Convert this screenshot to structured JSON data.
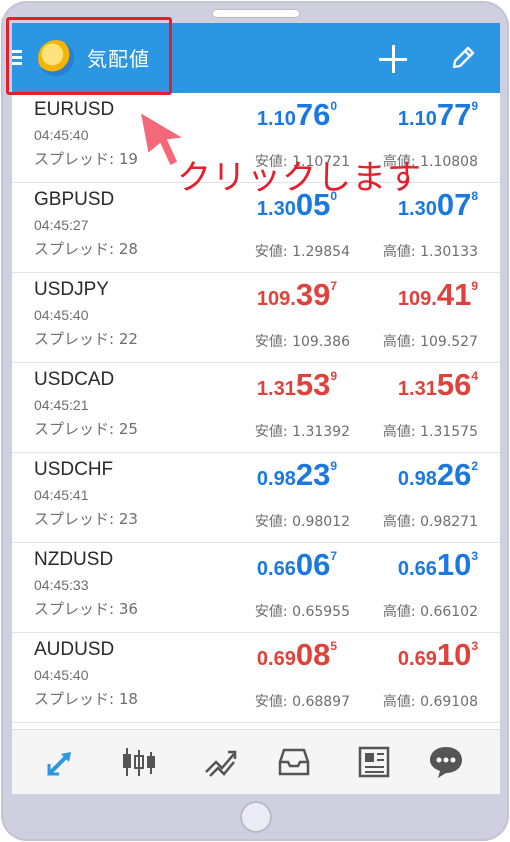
{
  "header": {
    "title": "気配値"
  },
  "spread_label": "スプレッド: ",
  "low_label": "安値: ",
  "high_label": "高値: ",
  "annotation": "クリックします",
  "colors": {
    "up": "#1a78e0",
    "down": "#e0413a",
    "appbar": "#2b96e2",
    "highlight": "#e41e2b"
  },
  "quotes": [
    {
      "symbol": "EURUSD",
      "time": "04:45:40",
      "spread": "19",
      "direction": "up",
      "bid": {
        "small": "1.10",
        "big": "76",
        "sup": "0"
      },
      "ask": {
        "small": "1.10",
        "big": "77",
        "sup": "9"
      },
      "low": "1.10721",
      "high": "1.10808"
    },
    {
      "symbol": "GBPUSD",
      "time": "04:45:27",
      "spread": "28",
      "direction": "up",
      "bid": {
        "small": "1.30",
        "big": "05",
        "sup": "0"
      },
      "ask": {
        "small": "1.30",
        "big": "07",
        "sup": "8"
      },
      "low": "1.29854",
      "high": "1.30133"
    },
    {
      "symbol": "USDJPY",
      "time": "04:45:40",
      "spread": "22",
      "direction": "down",
      "bid": {
        "small": "109.",
        "big": "39",
        "sup": "7"
      },
      "ask": {
        "small": "109.",
        "big": "41",
        "sup": "9"
      },
      "low": "109.386",
      "high": "109.527"
    },
    {
      "symbol": "USDCAD",
      "time": "04:45:21",
      "spread": "25",
      "direction": "down",
      "bid": {
        "small": "1.31",
        "big": "53",
        "sup": "9"
      },
      "ask": {
        "small": "1.31",
        "big": "56",
        "sup": "4"
      },
      "low": "1.31392",
      "high": "1.31575"
    },
    {
      "symbol": "USDCHF",
      "time": "04:45:41",
      "spread": "23",
      "direction": "up",
      "bid": {
        "small": "0.98",
        "big": "23",
        "sup": "9"
      },
      "ask": {
        "small": "0.98",
        "big": "26",
        "sup": "2"
      },
      "low": "0.98012",
      "high": "0.98271"
    },
    {
      "symbol": "NZDUSD",
      "time": "04:45:33",
      "spread": "36",
      "direction": "up",
      "bid": {
        "small": "0.66",
        "big": "06",
        "sup": "7"
      },
      "ask": {
        "small": "0.66",
        "big": "10",
        "sup": "3"
      },
      "low": "0.65955",
      "high": "0.66102"
    },
    {
      "symbol": "AUDUSD",
      "time": "04:45:40",
      "spread": "18",
      "direction": "down",
      "bid": {
        "small": "0.69",
        "big": "08",
        "sup": "5"
      },
      "ask": {
        "small": "0.69",
        "big": "10",
        "sup": "3"
      },
      "low": "0.68897",
      "high": "0.69108"
    }
  ],
  "nav": [
    "quotes-icon",
    "chart-icon",
    "trade-icon",
    "history-icon",
    "news-icon",
    "chat-icon"
  ]
}
